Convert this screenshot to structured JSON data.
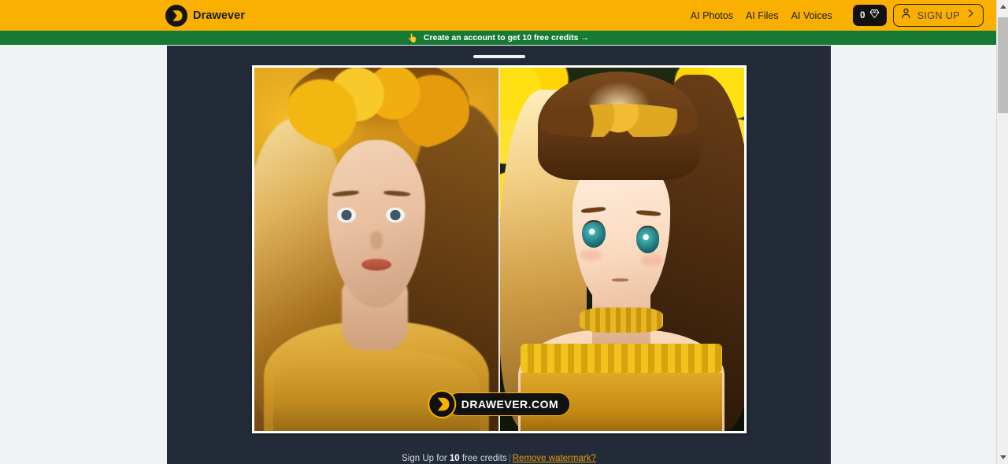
{
  "header": {
    "brand_name": "Drawever",
    "logo_icon": "drawever-logo-icon",
    "nav": [
      {
        "label": "AI Photos",
        "name": "nav-ai-photos"
      },
      {
        "label": "AI Files",
        "name": "nav-ai-files"
      },
      {
        "label": "AI Voices",
        "name": "nav-ai-voices"
      }
    ],
    "credits": {
      "count": "0",
      "icon": "gem-icon"
    },
    "signup": {
      "label": "SIGN UP",
      "icon": "user-icon",
      "chevron": "chevron-right-icon"
    }
  },
  "banner": {
    "icon": "pointing-hand-icon",
    "text": "Create an account to get 10 free credits →"
  },
  "modal": {
    "drag_handle": "drag-handle",
    "comparison": {
      "left_pane": {
        "label": "original-photo",
        "alt": "Woman with yellow flower crown photo"
      },
      "right_pane": {
        "label": "anime-result",
        "alt": "Anime-style portrait of woman with yellow flower crown"
      }
    },
    "watermark": {
      "text": "DRAWEVER.COM",
      "icon": "drawever-logo-icon"
    },
    "footer": {
      "prefix": "Sign Up for ",
      "credits": "10",
      "suffix": " free credits",
      "separator": "|",
      "link": "Remove watermark?"
    }
  },
  "scrollbar": {
    "up_arrow": "scroll-up-arrow-icon",
    "down_arrow": "scroll-down-arrow-icon",
    "thumb": "scrollbar-thumb"
  },
  "colors": {
    "brand_orange": "#f9b000",
    "banner_green": "#167a34",
    "modal_bg": "#232a38",
    "link_orange": "#e39b13",
    "page_bg": "#f1f2f4"
  }
}
